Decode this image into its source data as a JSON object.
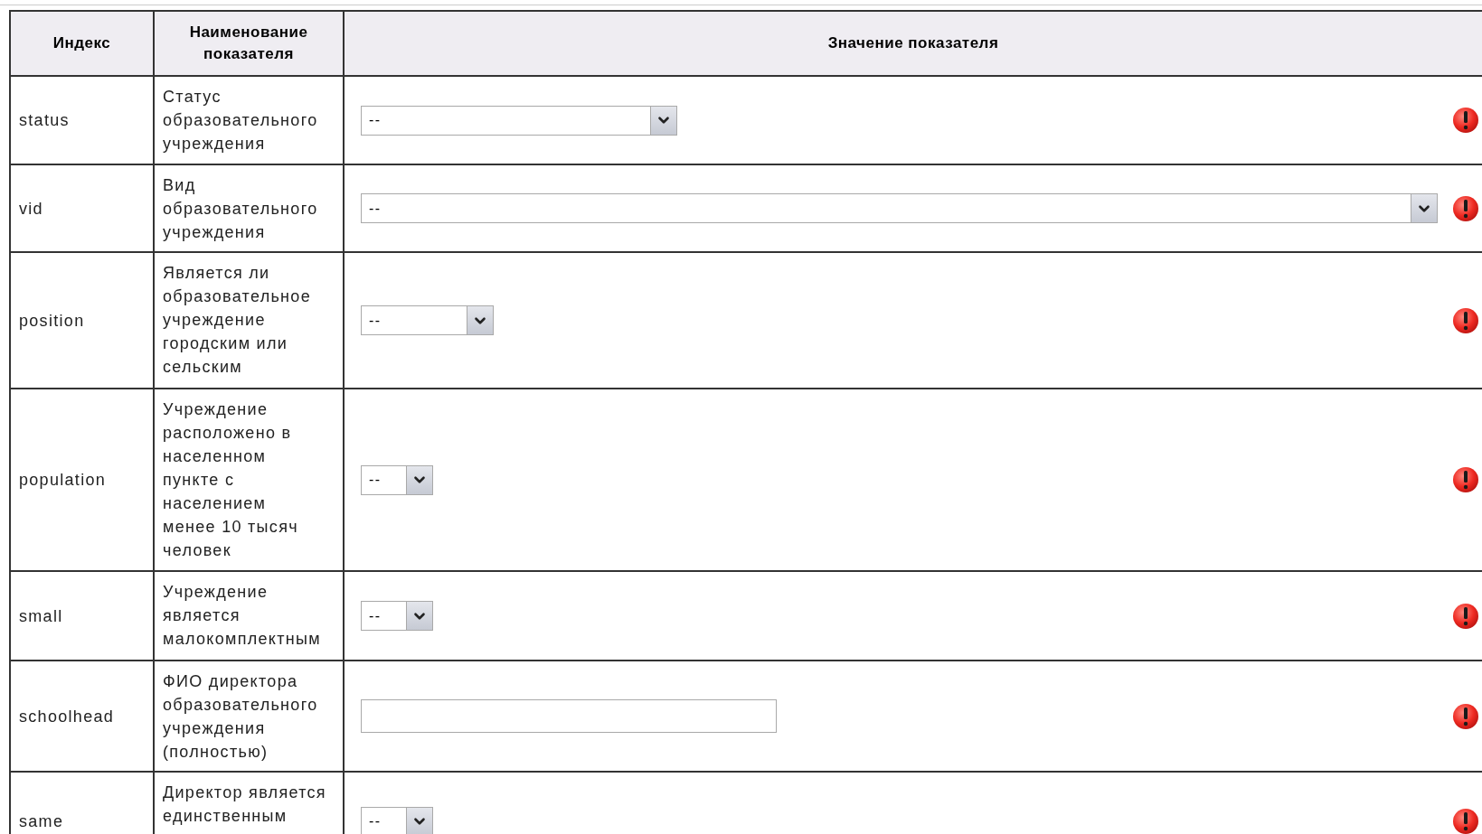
{
  "table": {
    "columns": [
      "Индекс",
      "Наименование\nпоказателя",
      "Значение показателя"
    ],
    "rows": [
      {
        "index": "status",
        "name": "Статус\nобразовательного\nучреждения",
        "field": {
          "kind": "select",
          "value": "--"
        },
        "error": true
      },
      {
        "index": "vid",
        "name": "Вид\nобразовательного\nучреждения",
        "field": {
          "kind": "select",
          "value": "--"
        },
        "error": true
      },
      {
        "index": "position",
        "name": "Является ли\nобразовательное\nучреждение\nгородским или\nсельским",
        "field": {
          "kind": "select",
          "value": "--"
        },
        "error": true
      },
      {
        "index": "population",
        "name": "Учреждение\nрасположено в\nнаселенном\nпункте с\nнаселением\nменее 10 тысяч\nчеловек",
        "field": {
          "kind": "select",
          "value": "--"
        },
        "error": true
      },
      {
        "index": "small",
        "name": "Учреждение\nявляется\nмалокомплектным",
        "field": {
          "kind": "select",
          "value": "--"
        },
        "error": true
      },
      {
        "index": "schoolhead",
        "name": "ФИО директора\nобразовательного\nучреждения\n(полностью)",
        "field": {
          "kind": "text"
        },
        "error": true
      },
      {
        "index": "same",
        "name": "Директор является\nединственным",
        "field": {
          "kind": "select",
          "value": "--"
        },
        "error": true
      }
    ]
  }
}
